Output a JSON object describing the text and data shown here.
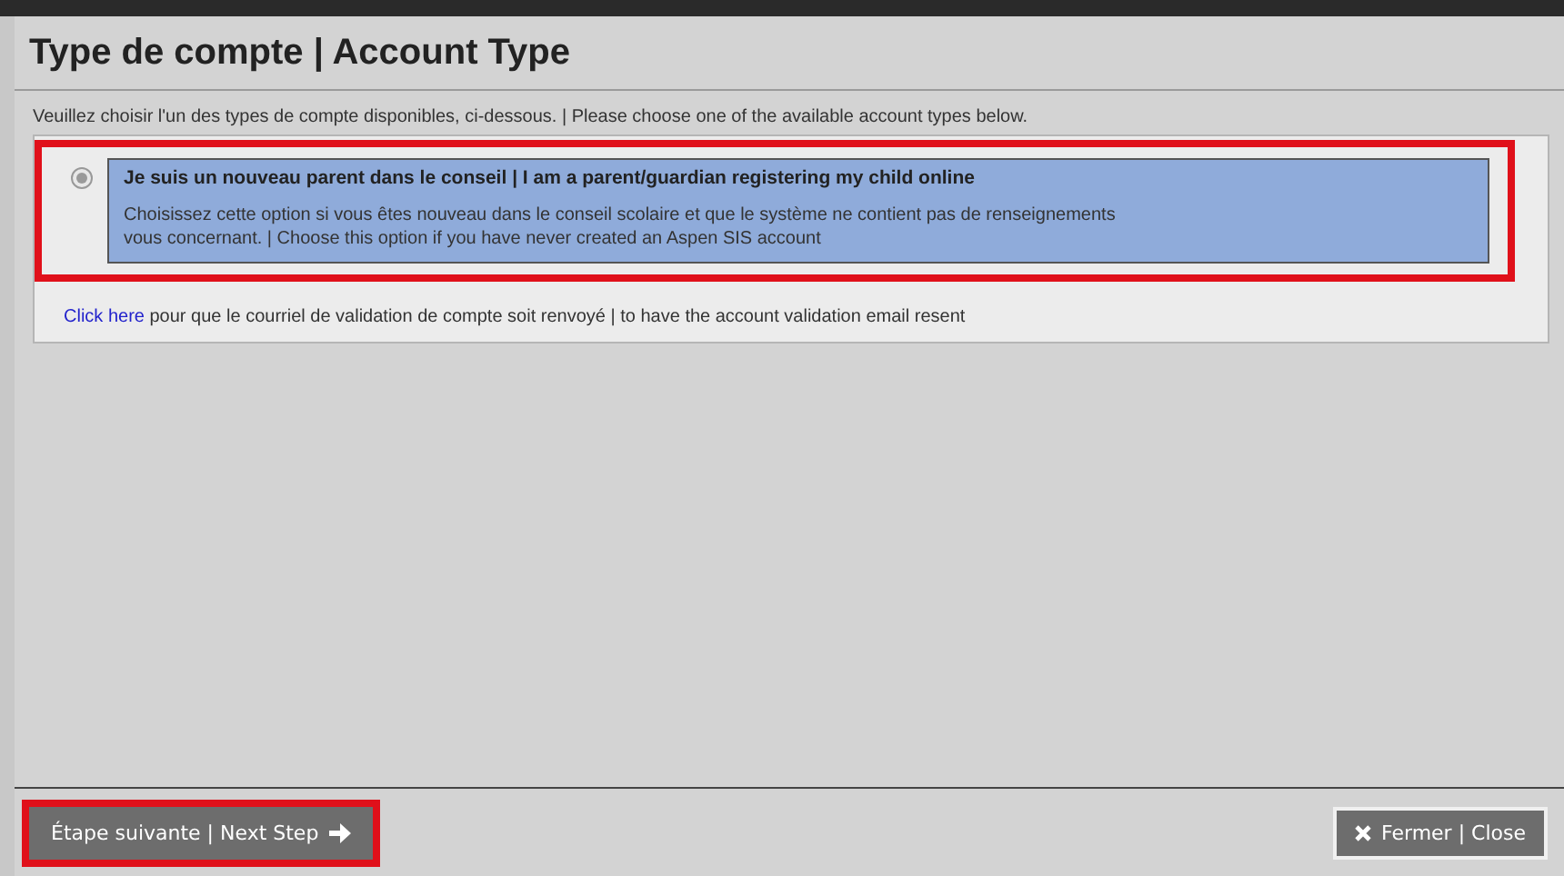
{
  "dialog": {
    "title": "Type de compte | Account Type",
    "instruction": "Veuillez choisir l'un des types de compte disponibles, ci-dessous. | Please choose one of the available account types below.",
    "options": [
      {
        "label": "Je suis un nouveau parent dans le conseil | I am a parent/guardian registering my child online",
        "description": "Choisissez cette option si vous êtes nouveau dans le conseil scolaire et que le système ne contient pas de renseignements vous concernant. | Choose this option if you have never created an Aspen SIS account",
        "selected": true,
        "highlighted": true
      }
    ],
    "resend": {
      "link": "Click here",
      "text": "pour que le courriel de validation de compte soit renvoyé | to have the account validation email resent"
    },
    "buttons": [
      {
        "kind": "next",
        "label": "Étape suivante | Next Step",
        "highlighted": true
      },
      {
        "kind": "close",
        "label": "Fermer | Close",
        "highlighted": false
      }
    ]
  }
}
